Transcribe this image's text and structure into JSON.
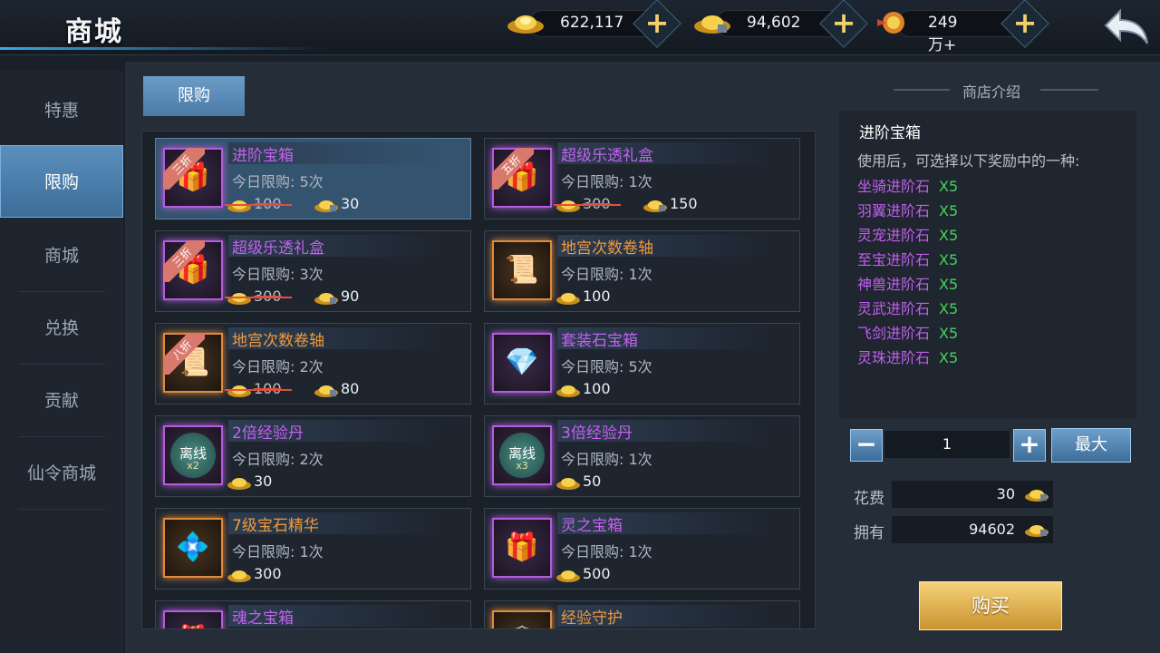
{
  "header": {
    "title": "商城",
    "resources": [
      {
        "icon": "gold-ingot-icon",
        "value": "622,117"
      },
      {
        "icon": "bound-gold-ingot-icon",
        "value": "94,602"
      },
      {
        "icon": "fire-token-icon",
        "value": "249万+"
      }
    ]
  },
  "sidebar": {
    "items": [
      {
        "label": "特惠",
        "active": false
      },
      {
        "label": "限购",
        "active": true
      },
      {
        "label": "商城",
        "active": false
      },
      {
        "label": "兑换",
        "active": false
      },
      {
        "label": "贡献",
        "active": false
      },
      {
        "label": "仙令商城",
        "active": false
      }
    ]
  },
  "tab": {
    "label": "限购"
  },
  "items": [
    {
      "name": "进阶宝箱",
      "limit": "今日限购: 5次",
      "old_price": "100",
      "price": "30",
      "discount": "三折",
      "icon": "purple-treasure-chest-icon",
      "selected": true
    },
    {
      "name": "超级乐透礼盒",
      "limit": "今日限购: 1次",
      "old_price": "300",
      "price": "150",
      "discount": "五折",
      "icon": "lottery-gift-box-icon"
    },
    {
      "name": "超级乐透礼盒",
      "limit": "今日限购: 3次",
      "old_price": "300",
      "price": "90",
      "discount": "三折",
      "icon": "lottery-gift-box-icon"
    },
    {
      "name": "地宫次数卷轴",
      "limit": "今日限购: 1次",
      "old_price": "",
      "price": "100",
      "discount": "",
      "icon": "dungeon-scroll-icon"
    },
    {
      "name": "地宫次数卷轴",
      "limit": "今日限购: 2次",
      "old_price": "100",
      "price": "80",
      "discount": "八折",
      "icon": "dungeon-scroll-icon"
    },
    {
      "name": "套装石宝箱",
      "limit": "今日限购: 5次",
      "old_price": "",
      "price": "100",
      "discount": "",
      "icon": "gem-chest-icon"
    },
    {
      "name": "2倍经验丹",
      "limit": "今日限购: 2次",
      "old_price": "",
      "price": "30",
      "discount": "",
      "icon": "offline-exp-icon",
      "badge": "离线",
      "multiplier": "x2"
    },
    {
      "name": "3倍经验丹",
      "limit": "今日限购: 1次",
      "old_price": "",
      "price": "50",
      "discount": "",
      "icon": "offline-exp-icon",
      "badge": "离线",
      "multiplier": "x3"
    },
    {
      "name": "7级宝石精华",
      "limit": "今日限购: 1次",
      "old_price": "",
      "price": "300",
      "discount": "",
      "icon": "crystal-icon"
    },
    {
      "name": "灵之宝箱",
      "limit": "今日限购: 1次",
      "old_price": "",
      "price": "500",
      "discount": "",
      "icon": "spirit-chest-icon"
    },
    {
      "name": "魂之宝箱",
      "limit": "",
      "old_price": "",
      "price": "",
      "discount": "",
      "icon": "soul-chest-icon"
    },
    {
      "name": "经验守护",
      "limit": "",
      "old_price": "",
      "price": "",
      "discount": "",
      "icon": "exp-guard-icon"
    }
  ],
  "detail": {
    "header": "商店介绍",
    "title": "进阶宝箱",
    "description": "使用后，可选择以下奖励中的一种:",
    "rewards": [
      {
        "name": "坐骑进阶石",
        "qty": "X5"
      },
      {
        "name": "羽翼进阶石",
        "qty": "X5"
      },
      {
        "name": "灵宠进阶石",
        "qty": "X5"
      },
      {
        "name": "至宝进阶石",
        "qty": "X5"
      },
      {
        "name": "神兽进阶石",
        "qty": "X5"
      },
      {
        "name": "灵武进阶石",
        "qty": "X5"
      },
      {
        "name": "飞剑进阶石",
        "qty": "X5"
      },
      {
        "name": "灵珠进阶石",
        "qty": "X5"
      }
    ],
    "quantity": "1",
    "max_label": "最大",
    "cost_label": "花费",
    "cost_value": "30",
    "own_label": "拥有",
    "own_value": "94602",
    "buy_label": "购买"
  }
}
